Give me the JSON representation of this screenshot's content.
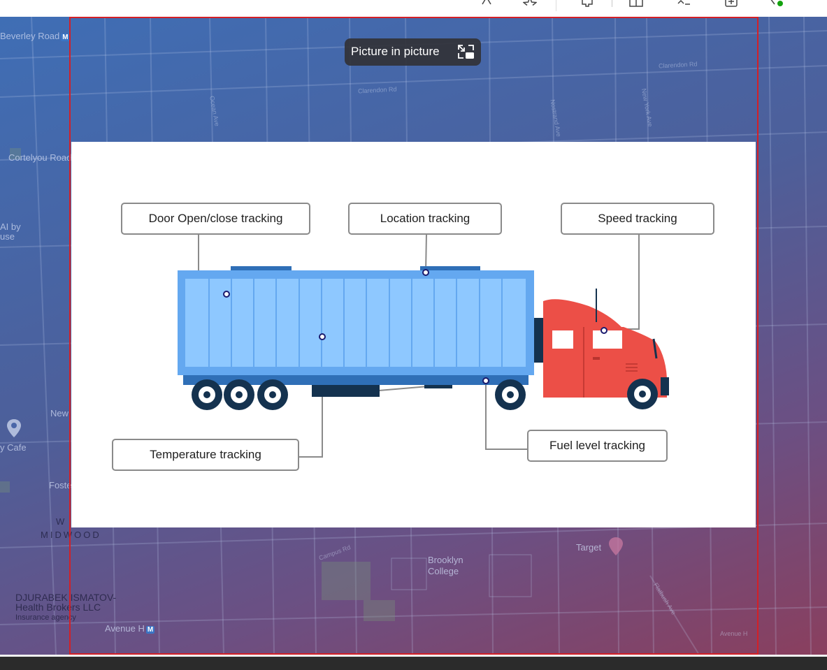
{
  "browser_toolbar": {
    "icons": [
      "read-aloud-icon",
      "favorite-icon",
      "extensions-icon",
      "split-screen-icon",
      "favorites-icon",
      "collections-icon",
      "copilot-icon"
    ]
  },
  "map": {
    "labels": {
      "beverley_road": "Beverley Road",
      "cortelyou_road": "Cortelyou Road",
      "ai_by_use": "AI by\nuse",
      "cafe": "y Cafe",
      "new": "New",
      "midwood": "MIDWOOD",
      "w": "W",
      "insurance_name": "DJURABEK ISMATOV-\nHealth Brokers LLC",
      "insurance_type": "Insurance agency",
      "avenue_h": "Avenue H",
      "brooklyn_college": "Brooklyn\nCollege",
      "target": "Target",
      "clarendon_rd_1": "Clarendon Rd",
      "clarendon_rd_2": "Clarendon Rd",
      "ocean_ave": "Ocean Ave",
      "nostrand_ave": "Nostrand Ave",
      "new_york_ave": "New York Ave",
      "flatbush_ave": "Flatbush Ave",
      "campus_rd": "Campus Rd",
      "avenue_h_small": "Avenue H",
      "foster": "Foste",
      "metro_badge": "M"
    }
  },
  "pip": {
    "badge_label": "Picture in picture",
    "badge_icon": "exit-pip-icon"
  },
  "video": {
    "callouts": {
      "door": "Door Open/close tracking",
      "location": "Location tracking",
      "speed": "Speed tracking",
      "temperature": "Temperature tracking",
      "fuel": "Fuel level tracking"
    },
    "colors": {
      "trailer": "#64a8f0",
      "trailer_inner": "#8ec8ff",
      "cab": "#ec4f47",
      "chassis": "#2f6fb7",
      "dark": "#14324f",
      "callout_border": "#8a8a8a"
    }
  },
  "colors": {
    "pip_border": "#d32027",
    "map_gradient_start": "#3f6eb5",
    "map_gradient_end": "#8a3f5e"
  }
}
